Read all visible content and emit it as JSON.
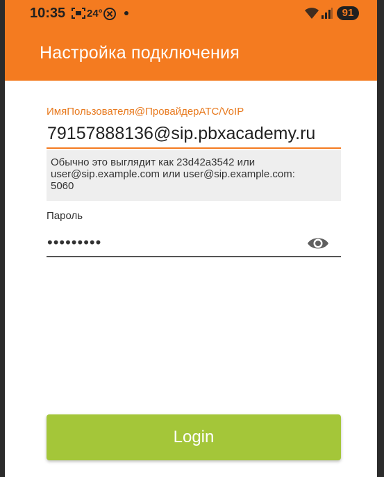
{
  "status_bar": {
    "time": "10:35",
    "temperature": "24°",
    "battery": "91",
    "icons": [
      "screenshot-icon",
      "x-circle-icon",
      "dot-icon",
      "wifi-icon",
      "signal-icon",
      "battery-icon"
    ]
  },
  "appbar": {
    "title": "Настройка подключения",
    "color": "#f47b20"
  },
  "form": {
    "username_label": "ИмяПользователя@ПровайдерАТС/VoIP",
    "username_value": "79157888136@sip.pbxacademy.ru",
    "hint_line1": "Обычно это выглядит как 23d42a3542 или",
    "hint_line2": "user@sip.example.com или user@sip.example.com:",
    "hint_line3": "5060",
    "password_label": "Пароль",
    "password_value": "•••••••••",
    "password_toggle_icon": "eye-icon"
  },
  "actions": {
    "login_label": "Login",
    "login_color": "#a4c639"
  }
}
